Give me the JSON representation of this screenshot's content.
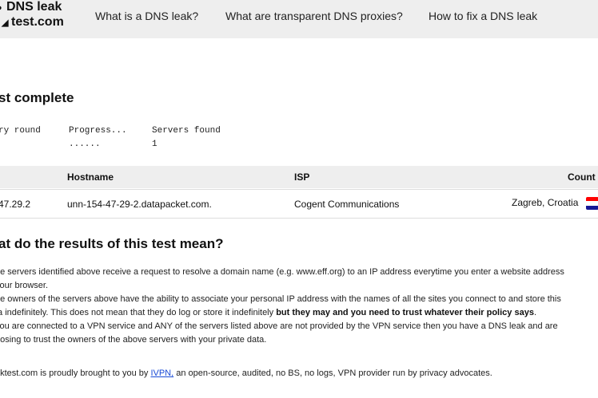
{
  "header": {
    "logo_line1": "DNS leak",
    "logo_line2": "test.com",
    "nav": [
      {
        "label": "What is a DNS leak?"
      },
      {
        "label": "What are transparent DNS proxies?"
      },
      {
        "label": "How to fix a DNS leak"
      }
    ]
  },
  "status": {
    "title": "st complete",
    "col1_label": "ry round",
    "col2_label": "Progress...",
    "col2_value": "......",
    "col3_label": "Servers found",
    "col3_value": "1"
  },
  "table": {
    "headers": {
      "hostname": "Hostname",
      "isp": "ISP",
      "country": "Count"
    },
    "rows": [
      {
        "ip": "47.29.2",
        "hostname": "unn-154-47-29-2.datapacket.com.",
        "isp": "Cogent Communications",
        "country": "Zagreb, Croatia",
        "flag_colors": [
          "#ff0000",
          "#ffffff",
          "#171796"
        ]
      }
    ]
  },
  "meaning": {
    "title": "at do the results of this test mean?",
    "p1_line1": "he servers identified above receive a request to resolve a domain name (e.g. www.eff.org) to an IP address everytime you enter a website address",
    "p1_line2": "your browser.",
    "p2_line1": "he owners of the servers above have the ability to associate your personal IP address with the names of all the sites you connect to and store this",
    "p2_line2_pre": "ta indefinitely. This does not mean that they do log or store it indefinitely ",
    "p2_line2_bold": "but they may and you need to trust whatever their policy says",
    "p2_line2_post": ".",
    "p3_line1": "you are connected to a VPN service and ANY of the servers listed above are not provided by the VPN service then you have a DNS leak and are",
    "p3_line2": "oosing to trust the owners of the above servers with your private data.",
    "footer_pre": "aktest.com is proudly brought to you by ",
    "footer_link": "IVPN,",
    "footer_post": " an open-source, audited, no BS, no logs, VPN provider run by privacy advocates."
  }
}
